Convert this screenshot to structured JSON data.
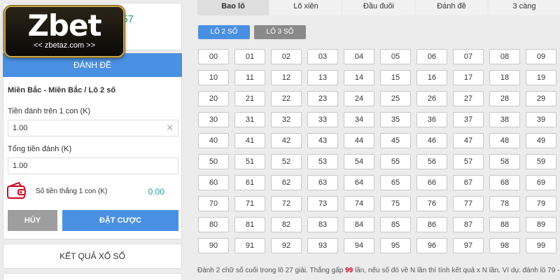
{
  "logo": {
    "wordmark": "Zbet",
    "subtext": "<< zbetaz.com >>"
  },
  "balance_partial": "57",
  "place_bet_header": "ĐÁNH ĐỀ",
  "form": {
    "region": "Miền Bắc - Miền Bắc / Lô 2 số",
    "stake_per_number_label": "Tiền đánh trên 1 con (K)",
    "stake_per_number_value": "1.00",
    "total_stake_label": "Tổng tiền đánh (K)",
    "total_stake_value": "1.00",
    "win_per_number_label": "Số tiền thắng 1 con (K)",
    "win_per_number_value": "0.00",
    "cancel_label": "HỦY",
    "place_bet_label": "ĐẶT CƯỢC"
  },
  "results_label": "KẾT QUẢ XỔ SỐ",
  "tabs": [
    "Bao lô",
    "Lô xiên",
    "Đầu đuôi",
    "Đánh đề",
    "3 càng"
  ],
  "active_tab": "Bao lô",
  "subtabs": [
    "LÔ 2 SỐ",
    "LÔ 3 SỐ"
  ],
  "active_subtab": "LÔ 2 SỐ",
  "numbers": [
    "00",
    "01",
    "02",
    "03",
    "04",
    "05",
    "06",
    "07",
    "08",
    "09",
    "10",
    "11",
    "12",
    "13",
    "14",
    "15",
    "16",
    "17",
    "18",
    "19",
    "20",
    "21",
    "22",
    "23",
    "24",
    "25",
    "26",
    "27",
    "28",
    "29",
    "30",
    "31",
    "32",
    "33",
    "34",
    "35",
    "36",
    "37",
    "38",
    "39",
    "40",
    "41",
    "42",
    "43",
    "44",
    "45",
    "46",
    "47",
    "48",
    "49",
    "50",
    "51",
    "52",
    "53",
    "54",
    "55",
    "56",
    "57",
    "58",
    "59",
    "60",
    "61",
    "62",
    "63",
    "64",
    "65",
    "66",
    "67",
    "68",
    "69",
    "70",
    "71",
    "72",
    "73",
    "74",
    "75",
    "76",
    "77",
    "78",
    "79",
    "80",
    "81",
    "82",
    "83",
    "84",
    "85",
    "86",
    "87",
    "88",
    "89",
    "90",
    "91",
    "92",
    "93",
    "94",
    "95",
    "96",
    "97",
    "98",
    "99"
  ],
  "description": {
    "before": "Đánh 2 chữ số cuối trong lô 27 giải. Thắng gấp ",
    "multiplier": "99",
    "after": " lần, nếu số đó về N lần thì tính kết quả x N lần. Ví dụ: đánh lô 79 -"
  },
  "colors": {
    "accent_blue": "#4a90e2",
    "gray_button": "#9e9e9e",
    "teal_value": "#1e9e8e",
    "highlight_red": "#d0021b"
  },
  "icons": {
    "wallet": "wallet-icon",
    "clear": "clear-icon"
  }
}
